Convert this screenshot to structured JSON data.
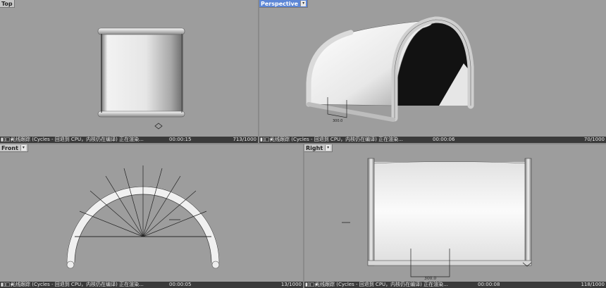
{
  "viewports": [
    {
      "id": "top",
      "label": "Top",
      "active": false,
      "status": {
        "icons": "▮▯□★",
        "engine": "光线跟踪 (Cycles - 回退到 CPU，内核仍在编译)   正在渲染...",
        "time": "00:00:15",
        "progress": "713/1000"
      }
    },
    {
      "id": "perspective",
      "label": "Perspective",
      "active": true,
      "status": {
        "icons": "▮▯□★",
        "engine": "光线跟踪 (Cycles - 回退到 CPU，内核仍在编译)   正在渲染...",
        "time": "00:00:06",
        "progress": "70/1000"
      }
    },
    {
      "id": "front",
      "label": "Front",
      "active": false,
      "status": {
        "icons": "▮▯□★",
        "engine": "光线跟踪 (Cycles - 回退到 CPU，内核仍在编译)   正在渲染...",
        "time": "00:00:05",
        "progress": "13/1000"
      }
    },
    {
      "id": "right",
      "label": "Right",
      "active": false,
      "status": {
        "icons": "▮▯□★",
        "engine": "光线跟踪 (Cycles - 回退到 CPU，内核仍在编译)   正在渲染...",
        "time": "00:00:08",
        "progress": "118/1000"
      }
    }
  ],
  "dimension_label": "300.0",
  "dropdown_glyph": "▾"
}
